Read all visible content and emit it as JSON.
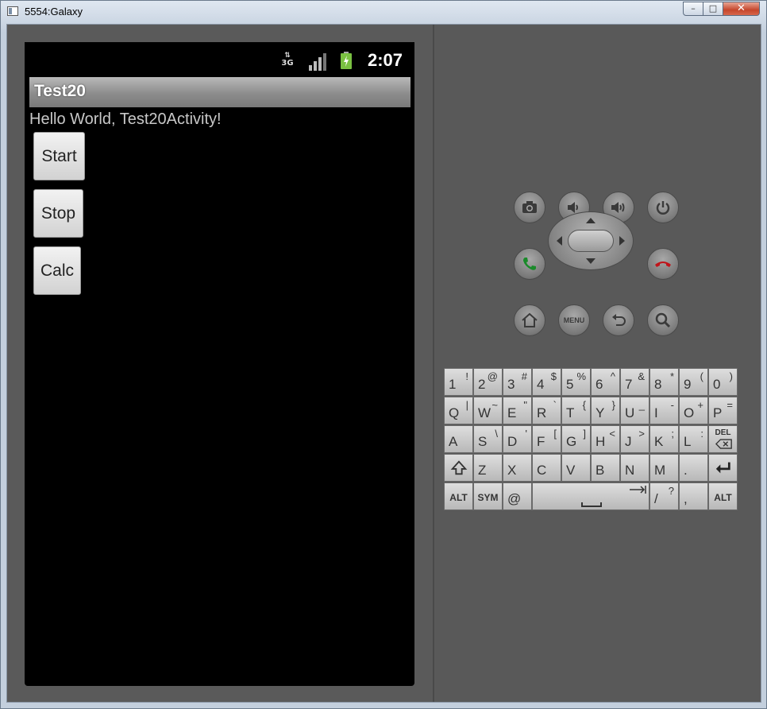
{
  "window": {
    "title": "5554:Galaxy",
    "minimize": "–",
    "maximize": "□",
    "close": "✕"
  },
  "status_bar": {
    "network": "3G",
    "time": "2:07"
  },
  "app": {
    "title": "Test20",
    "hello": "Hello World, Test20Activity!",
    "buttons": [
      "Start",
      "Stop",
      "Calc"
    ]
  },
  "controls": {
    "menu_label": "MENU",
    "icons": [
      "camera-icon",
      "volume-down-icon",
      "volume-up-icon",
      "power-icon",
      "call-icon",
      "end-call-icon",
      "home-icon",
      "back-icon",
      "search-icon"
    ]
  },
  "keyboard": {
    "rows": [
      [
        {
          "k": "1",
          "a": "!"
        },
        {
          "k": "2",
          "a": "@"
        },
        {
          "k": "3",
          "a": "#"
        },
        {
          "k": "4",
          "a": "$"
        },
        {
          "k": "5",
          "a": "%"
        },
        {
          "k": "6",
          "a": "^"
        },
        {
          "k": "7",
          "a": "&"
        },
        {
          "k": "8",
          "a": "*"
        },
        {
          "k": "9",
          "a": "("
        },
        {
          "k": "0",
          "a": ")"
        }
      ],
      [
        {
          "k": "Q",
          "a": "|"
        },
        {
          "k": "W",
          "a": "~"
        },
        {
          "k": "E",
          "a": "\""
        },
        {
          "k": "R",
          "a": "`"
        },
        {
          "k": "T",
          "a": "{"
        },
        {
          "k": "Y",
          "a": "}"
        },
        {
          "k": "U",
          "a": "_"
        },
        {
          "k": "I",
          "a": "-"
        },
        {
          "k": "O",
          "a": "+"
        },
        {
          "k": "P",
          "a": "="
        }
      ],
      [
        {
          "k": "A",
          "a": ""
        },
        {
          "k": "S",
          "a": "\\"
        },
        {
          "k": "D",
          "a": "'"
        },
        {
          "k": "F",
          "a": "["
        },
        {
          "k": "G",
          "a": "]"
        },
        {
          "k": "H",
          "a": "<"
        },
        {
          "k": "J",
          "a": ">"
        },
        {
          "k": "K",
          "a": ";"
        },
        {
          "k": "L",
          "a": ":"
        },
        {
          "k": "DEL",
          "a": ""
        }
      ],
      [
        {
          "k": "shift",
          "a": ""
        },
        {
          "k": "Z",
          "a": ""
        },
        {
          "k": "X",
          "a": ""
        },
        {
          "k": "C",
          "a": ""
        },
        {
          "k": "V",
          "a": ""
        },
        {
          "k": "B",
          "a": ""
        },
        {
          "k": "N",
          "a": ""
        },
        {
          "k": "M",
          "a": ""
        },
        {
          "k": ".",
          "a": ""
        },
        {
          "k": "enter",
          "a": ""
        }
      ],
      [
        {
          "k": "ALT",
          "a": ""
        },
        {
          "k": "SYM",
          "a": ""
        },
        {
          "k": "@",
          "a": ""
        },
        {
          "k": "space",
          "a": ""
        },
        {
          "k": "/",
          "a": "?"
        },
        {
          "k": ",",
          "a": ""
        },
        {
          "k": "ALT",
          "a": ""
        }
      ]
    ]
  }
}
